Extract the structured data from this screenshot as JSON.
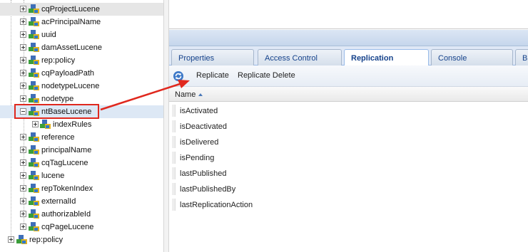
{
  "tree": {
    "nodes": [
      {
        "label": "cqProjectLucene",
        "level": 1,
        "expander": "plus"
      },
      {
        "label": "acPrincipalName",
        "level": 1,
        "expander": "plus"
      },
      {
        "label": "uuid",
        "level": 1,
        "expander": "plus"
      },
      {
        "label": "damAssetLucene",
        "level": 1,
        "expander": "plus"
      },
      {
        "label": "rep:policy",
        "level": 1,
        "expander": "plus"
      },
      {
        "label": "cqPayloadPath",
        "level": 1,
        "expander": "plus"
      },
      {
        "label": "nodetypeLucene",
        "level": 1,
        "expander": "plus"
      },
      {
        "label": "nodetype",
        "level": 1,
        "expander": "plus"
      },
      {
        "label": "ntBaseLucene",
        "level": 1,
        "expander": "minus",
        "selected": true
      },
      {
        "label": "indexRules",
        "level": 2,
        "expander": "plus"
      },
      {
        "label": "reference",
        "level": 1,
        "expander": "plus"
      },
      {
        "label": "principalName",
        "level": 1,
        "expander": "plus"
      },
      {
        "label": "cqTagLucene",
        "level": 1,
        "expander": "plus"
      },
      {
        "label": "lucene",
        "level": 1,
        "expander": "plus"
      },
      {
        "label": "repTokenIndex",
        "level": 1,
        "expander": "plus"
      },
      {
        "label": "externalId",
        "level": 1,
        "expander": "plus"
      },
      {
        "label": "authorizableId",
        "level": 1,
        "expander": "plus"
      },
      {
        "label": "cqPageLucene",
        "level": 1,
        "expander": "plus"
      },
      {
        "label": "rep:policy",
        "level": 0,
        "expander": "plus"
      }
    ]
  },
  "tabs": [
    {
      "label": "Properties",
      "active": false
    },
    {
      "label": "Access Control",
      "active": false
    },
    {
      "label": "Replication",
      "active": true
    },
    {
      "label": "Console",
      "active": false
    },
    {
      "label": "B",
      "active": false
    }
  ],
  "toolbar": {
    "replicate_label": "Replicate",
    "replicate_delete_label": "Replicate Delete",
    "icon": "refresh-icon"
  },
  "grid": {
    "column_header": "Name",
    "sort": "ascending",
    "rows": [
      "isActivated",
      "isDeactivated",
      "isDelivered",
      "isPending",
      "lastPublished",
      "lastPublishedBy",
      "lastReplicationAction"
    ]
  },
  "annotation": {
    "highlight_color": "#e0281e",
    "points_to": "toolbar.replicate_label"
  },
  "colors": {
    "tab_text": "#15428b",
    "selection": "#dde8f5",
    "accent_border": "#99bbe8"
  }
}
